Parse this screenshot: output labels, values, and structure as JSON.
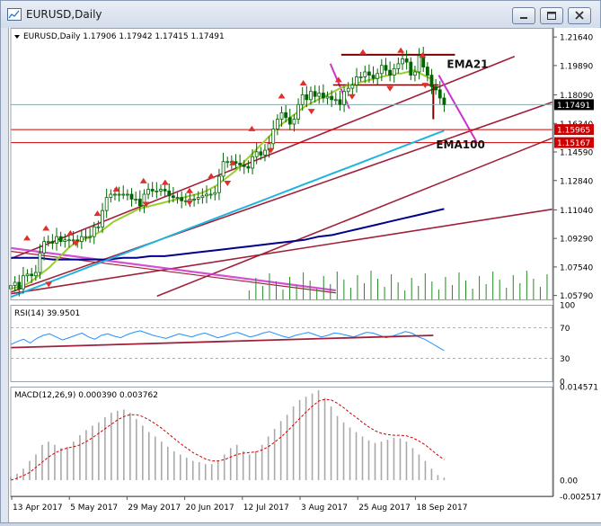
{
  "window": {
    "title": "EURUSD,Daily",
    "icon": "chart-window-icon",
    "buttons": [
      "minimize-icon",
      "restore-icon",
      "close-icon"
    ]
  },
  "colors": {
    "candle": "#006400",
    "ema21": "#9ACD32",
    "ema100": "#1fb4e0",
    "ema_slow": "#00008b",
    "channel": "#a0203a",
    "magenta": "#cc33cc",
    "rsi_line": "#1e90ff",
    "macd_hist": "#a9a9a9",
    "macd_signal": "#cc0000",
    "arrow": "#e0302c",
    "volume": "#228b22"
  },
  "chart_data": [
    {
      "type": "line",
      "panel": "price",
      "header": "EURUSD,Daily",
      "ohlc": [
        "1.17906",
        "1.17942",
        "1.17415",
        "1.17491"
      ],
      "ylim": [
        1.0555,
        1.222
      ],
      "y_ticks": [
        "1.21640",
        "1.19890",
        "1.18090",
        "1.16340",
        "1.14590",
        "1.12840",
        "1.11040",
        "1.09290",
        "1.07540",
        "1.05790"
      ],
      "price_labels": [
        {
          "value": 1.17491,
          "text": "1.17491",
          "color": "#000000",
          "text_color": "#ffffff"
        },
        {
          "value": 1.15965,
          "text": "1.15965",
          "color": "#cc0000",
          "text_color": "#ffffff"
        },
        {
          "value": 1.15167,
          "text": "1.15167",
          "color": "#cc0000",
          "text_color": "#ffffff"
        }
      ],
      "annotations": [
        "EMA21",
        "EMA100"
      ],
      "x_labels": [
        "13 Apr 2017",
        "5 May 2017",
        "29 May 2017",
        "20 Jun 2017",
        "12 Jul 2017",
        "3 Aug 2017",
        "25 Aug 2017",
        "18 Sep 2017"
      ],
      "closes": [
        1.064,
        1.066,
        1.062,
        1.07,
        1.071,
        1.07,
        1.072,
        1.084,
        1.091,
        1.091,
        1.09,
        1.094,
        1.091,
        1.092,
        1.092,
        1.092,
        1.091,
        1.094,
        1.094,
        1.094,
        1.1,
        1.1,
        1.11,
        1.118,
        1.12,
        1.12,
        1.12,
        1.12,
        1.12,
        1.117,
        1.117,
        1.113,
        1.12,
        1.123,
        1.122,
        1.122,
        1.123,
        1.122,
        1.119,
        1.118,
        1.118,
        1.116,
        1.116,
        1.117,
        1.117,
        1.118,
        1.119,
        1.12,
        1.12,
        1.121,
        1.131,
        1.14,
        1.14,
        1.14,
        1.139,
        1.138,
        1.137,
        1.136,
        1.143,
        1.146,
        1.144,
        1.147,
        1.151,
        1.16,
        1.166,
        1.17,
        1.167,
        1.163,
        1.166,
        1.175,
        1.181,
        1.178,
        1.183,
        1.18,
        1.182,
        1.179,
        1.18,
        1.178,
        1.178,
        1.175,
        1.183,
        1.185,
        1.187,
        1.192,
        1.192,
        1.195,
        1.193,
        1.191,
        1.194,
        1.199,
        1.196,
        1.193,
        1.197,
        1.2,
        1.203,
        1.201,
        1.193,
        1.195,
        1.205,
        1.198,
        1.193,
        1.186,
        1.184,
        1.179,
        1.175
      ],
      "ema21": [
        1.062,
        1.063,
        1.064,
        1.066,
        1.069,
        1.072,
        1.075,
        1.079,
        1.083,
        1.087,
        1.09,
        1.092,
        1.093,
        1.095,
        1.097,
        1.1,
        1.103,
        1.105,
        1.107,
        1.109,
        1.111,
        1.112,
        1.113,
        1.114,
        1.115,
        1.116,
        1.117,
        1.118,
        1.119,
        1.12,
        1.121,
        1.123,
        1.125,
        1.128,
        1.131,
        1.134,
        1.138,
        1.142,
        1.146,
        1.15,
        1.154,
        1.158,
        1.162,
        1.165,
        1.168,
        1.171,
        1.174,
        1.176,
        1.178,
        1.18,
        1.182,
        1.184,
        1.186,
        1.187,
        1.188,
        1.189,
        1.19,
        1.191,
        1.192,
        1.193,
        1.194,
        1.194,
        1.195,
        1.196,
        1.194,
        1.192,
        1.19
      ],
      "ema100": [
        1.057,
        1.06,
        1.063,
        1.066,
        1.069,
        1.072,
        1.075,
        1.078,
        1.081,
        1.084,
        1.087,
        1.09,
        1.093,
        1.096,
        1.099,
        1.102,
        1.105,
        1.108,
        1.111,
        1.114,
        1.117,
        1.12,
        1.123,
        1.126,
        1.129,
        1.132,
        1.135,
        1.138,
        1.141,
        1.144,
        1.147,
        1.15,
        1.153,
        1.156,
        1.159
      ],
      "ema_slow": [
        1.081,
        1.081,
        1.081,
        1.08,
        1.08,
        1.08,
        1.08,
        1.08,
        1.081,
        1.081,
        1.082,
        1.082,
        1.083,
        1.084,
        1.085,
        1.086,
        1.087,
        1.088,
        1.089,
        1.09,
        1.091,
        1.092,
        1.094,
        1.095,
        1.097,
        1.099,
        1.101,
        1.103,
        1.105,
        1.107,
        1.109,
        1.111
      ]
    },
    {
      "type": "line",
      "panel": "rsi",
      "header": "RSI(14) 39.9501",
      "ylim": [
        0,
        100
      ],
      "y_ticks": [
        "100",
        "70",
        "30",
        "0"
      ],
      "levels": [
        70,
        30
      ],
      "values": [
        48,
        52,
        55,
        50,
        56,
        60,
        62,
        58,
        54,
        57,
        60,
        63,
        58,
        55,
        60,
        62,
        59,
        57,
        61,
        64,
        66,
        63,
        60,
        58,
        56,
        59,
        62,
        60,
        58,
        61,
        63,
        60,
        57,
        59,
        62,
        64,
        61,
        58,
        60,
        63,
        65,
        62,
        59,
        57,
        60,
        62,
        64,
        61,
        58,
        60,
        63,
        62,
        60,
        58,
        61,
        64,
        63,
        60,
        57,
        59,
        62,
        65,
        63,
        58,
        55,
        50,
        45,
        40
      ]
    },
    {
      "type": "bar",
      "panel": "macd",
      "header": "MACD(12,26,9) 0.000390 0.003762",
      "y_ticks": [
        "0.014571",
        "0.00",
        "-0.002517"
      ],
      "ylim": [
        -0.002517,
        0.014571
      ],
      "histogram": [
        0.0005,
        0.001,
        0.0018,
        0.003,
        0.004,
        0.0055,
        0.006,
        0.0055,
        0.005,
        0.0052,
        0.006,
        0.007,
        0.0078,
        0.0085,
        0.009,
        0.0098,
        0.0105,
        0.0108,
        0.011,
        0.0105,
        0.0095,
        0.0085,
        0.0075,
        0.0068,
        0.006,
        0.0052,
        0.0045,
        0.004,
        0.0035,
        0.003,
        0.0028,
        0.0025,
        0.0025,
        0.003,
        0.004,
        0.005,
        0.0055,
        0.0045,
        0.004,
        0.0045,
        0.0055,
        0.0068,
        0.008,
        0.0092,
        0.0102,
        0.0115,
        0.0125,
        0.013,
        0.0135,
        0.014,
        0.0128,
        0.0115,
        0.01,
        0.009,
        0.0082,
        0.0075,
        0.0068,
        0.0062,
        0.0058,
        0.006,
        0.0063,
        0.0066,
        0.0065,
        0.006,
        0.005,
        0.004,
        0.003,
        0.0018,
        0.0008,
        0.0004
      ],
      "signal": [
        0.0,
        0.0003,
        0.0007,
        0.0012,
        0.002,
        0.0028,
        0.0036,
        0.0042,
        0.0047,
        0.005,
        0.0052,
        0.0055,
        0.006,
        0.0066,
        0.0073,
        0.008,
        0.0087,
        0.0094,
        0.0099,
        0.0102,
        0.0102,
        0.0099,
        0.0094,
        0.0088,
        0.0081,
        0.0073,
        0.0065,
        0.0057,
        0.005,
        0.0043,
        0.0038,
        0.0033,
        0.003,
        0.003,
        0.0032,
        0.0036,
        0.004,
        0.0042,
        0.0043,
        0.0044,
        0.0047,
        0.0052,
        0.0059,
        0.0067,
        0.0076,
        0.0086,
        0.0096,
        0.0106,
        0.0115,
        0.0123,
        0.0126,
        0.0125,
        0.012,
        0.0113,
        0.0105,
        0.0098,
        0.009,
        0.0083,
        0.0077,
        0.0073,
        0.0071,
        0.007,
        0.007,
        0.0069,
        0.0066,
        0.0061,
        0.0055,
        0.0047,
        0.0039,
        0.0032
      ]
    }
  ]
}
